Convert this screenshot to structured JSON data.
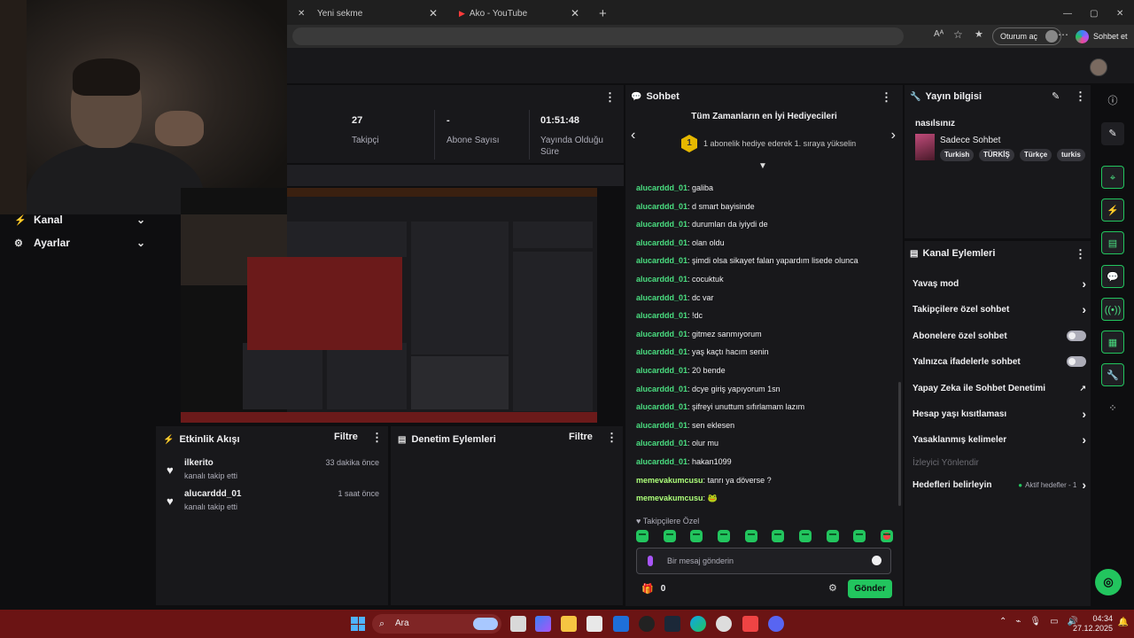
{
  "browser": {
    "tabs": [
      {
        "label": "Yeni sekme"
      },
      {
        "label": "Ako - YouTube"
      }
    ],
    "new_tab": "+",
    "sign_in": "Oturum aç",
    "copilot": "Sohbet et",
    "window_controls": [
      "—",
      "▢",
      "✕"
    ]
  },
  "sidebar": {
    "items": [
      {
        "label": "Kanal",
        "icon": "lightning-icon"
      },
      {
        "label": "Ayarlar",
        "icon": "gear-icon"
      }
    ]
  },
  "stats": [
    {
      "value": "27",
      "label": "Takipçi"
    },
    {
      "value": "-",
      "label": "Abone Sayısı"
    },
    {
      "value": "01:51:48",
      "label": "Yayında Olduğu Süre"
    }
  ],
  "activity": {
    "title": "Etkinlik Akışı",
    "filter": "Filtre",
    "items": [
      {
        "name": "ilkerito",
        "desc": "kanalı takip etti",
        "time": "33 dakika önce"
      },
      {
        "name": "alucarddd_01",
        "desc": "kanalı takip etti",
        "time": "1 saat önce"
      }
    ]
  },
  "moderation": {
    "title": "Denetim Eylemleri",
    "filter": "Filtre"
  },
  "chat": {
    "title": "Sohbet",
    "gift_title": "Tüm Zamanların en İyi Hediyecileri",
    "gift_rank": "1",
    "gift_text": "1 abonelik hediye ederek 1. sıraya yükselin",
    "messages": [
      {
        "user": "alucarddd_01",
        "text": "galiba"
      },
      {
        "user": "alucarddd_01",
        "text": "d smart bayisinde"
      },
      {
        "user": "alucarddd_01",
        "text": "durumları da iyiydi de"
      },
      {
        "user": "alucarddd_01",
        "text": "olan oldu"
      },
      {
        "user": "alucarddd_01",
        "text": "şimdi olsa sikayet falan yapardım lisede olunca"
      },
      {
        "user": "alucarddd_01",
        "text": "cocuktuk"
      },
      {
        "user": "alucarddd_01",
        "text": "dc var"
      },
      {
        "user": "alucarddd_01",
        "text": "!dc"
      },
      {
        "user": "alucarddd_01",
        "text": "gitmez sanmıyorum"
      },
      {
        "user": "alucarddd_01",
        "text": "yaş kaçtı hacım senin"
      },
      {
        "user": "alucarddd_01",
        "text": "20 bende"
      },
      {
        "user": "alucarddd_01",
        "text": "dcye giriş yapıyorum 1sn"
      },
      {
        "user": "alucarddd_01",
        "text": "şifreyi unuttum sıfırlamam lazım"
      },
      {
        "user": "alucarddd_01",
        "text": "sen eklesen"
      },
      {
        "user": "alucarddd_01",
        "text": "olur mu"
      },
      {
        "user": "alucarddd_01",
        "text": "hakan1099"
      },
      {
        "user": "memevakumcusu",
        "text": "tanrı ya döverse ?"
      },
      {
        "user": "memevakumcusu",
        "text": "🐸"
      }
    ],
    "followers_only": "Takipçilere Özel",
    "input_placeholder": "Bir mesaj gönderin",
    "points": "0",
    "send": "Gönder"
  },
  "stream_info": {
    "title": "Yayın bilgisi",
    "stream_title": "nasılsınız",
    "category": "Sadece Sohbet",
    "tags": [
      "Turkish",
      "TÜRKİŞ",
      "Türkçe",
      "turkis"
    ]
  },
  "channel_actions": {
    "title": "Kanal Eylemleri",
    "rows": [
      {
        "label": "Yavaş mod",
        "control": "chevron"
      },
      {
        "label": "Takipçilere özel sohbet",
        "control": "chevron"
      },
      {
        "label": "Abonelere özel sohbet",
        "control": "toggle"
      },
      {
        "label": "Yalnızca ifadelerle sohbet",
        "control": "toggle"
      },
      {
        "label": "Yapay Zeka ile Sohbet Denetimi",
        "control": "external"
      },
      {
        "label": "Hesap yaşı kısıtlaması",
        "control": "chevron"
      },
      {
        "label": "Yasaklanmış kelimeler",
        "control": "chevron"
      },
      {
        "label": "İzleyici Yönlendir",
        "control": "disabled"
      },
      {
        "label": "Hedefleri belirleyin",
        "control": "goal",
        "goal": "Aktif hedefler - 1"
      }
    ]
  },
  "taskbar": {
    "search": "Ara",
    "time": "04:34",
    "date": "27.12.2025"
  },
  "colors": {
    "accent": "#22c55e",
    "username": "#4ade80",
    "panel": "#18181b",
    "background": "#0e0e10",
    "taskbar": "#6b1414"
  }
}
